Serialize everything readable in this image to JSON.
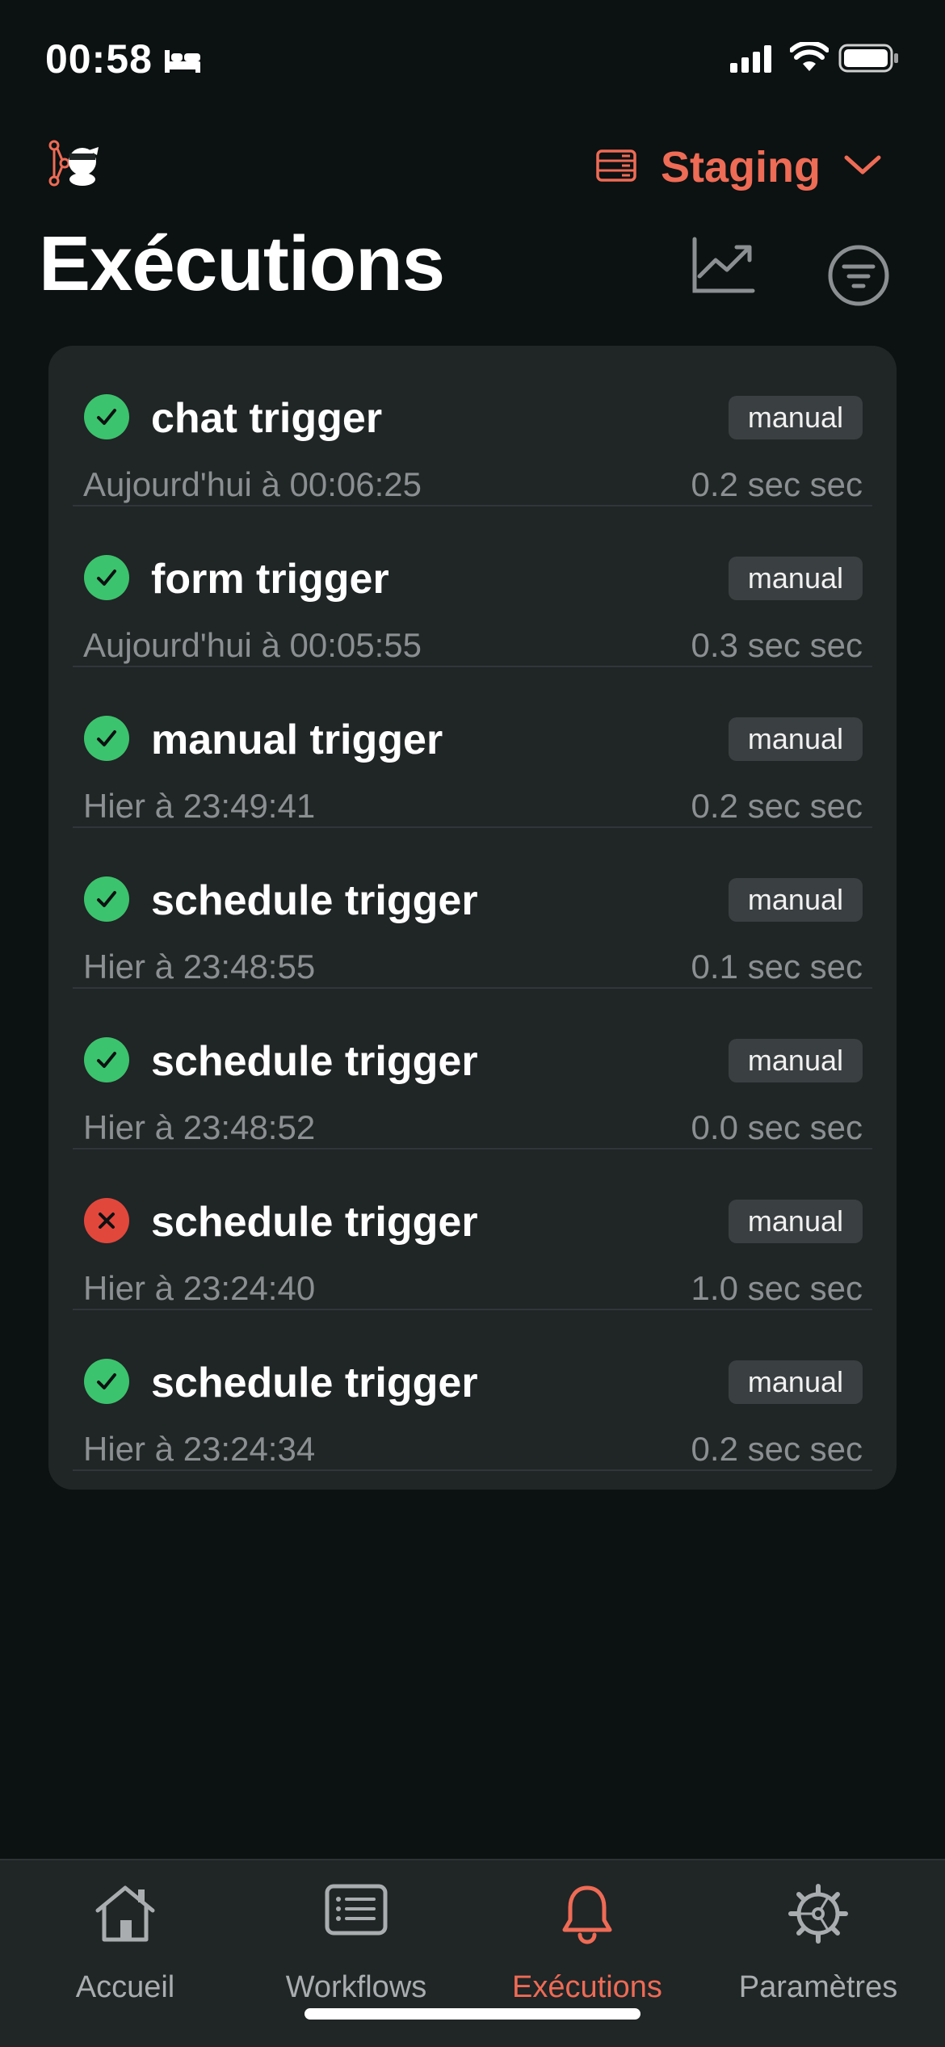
{
  "status_bar": {
    "time": "00:58"
  },
  "header": {
    "environment": "Staging",
    "title": "Exécutions"
  },
  "executions": [
    {
      "name": "chat trigger",
      "mode": "manual",
      "time": "Aujourd'hui à 00:06:25",
      "duration": "0.2 sec sec",
      "status": "success"
    },
    {
      "name": "form trigger",
      "mode": "manual",
      "time": "Aujourd'hui à 00:05:55",
      "duration": "0.3 sec sec",
      "status": "success"
    },
    {
      "name": "manual trigger",
      "mode": "manual",
      "time": "Hier à 23:49:41",
      "duration": "0.2 sec sec",
      "status": "success"
    },
    {
      "name": "schedule trigger",
      "mode": "manual",
      "time": "Hier à 23:48:55",
      "duration": "0.1 sec sec",
      "status": "success"
    },
    {
      "name": "schedule trigger",
      "mode": "manual",
      "time": "Hier à 23:48:52",
      "duration": "0.0 sec sec",
      "status": "success"
    },
    {
      "name": "schedule trigger",
      "mode": "manual",
      "time": "Hier à 23:24:40",
      "duration": "1.0 sec sec",
      "status": "error"
    },
    {
      "name": "schedule trigger",
      "mode": "manual",
      "time": "Hier à 23:24:34",
      "duration": "0.2 sec sec",
      "status": "success"
    }
  ],
  "tabs": [
    {
      "label": "Accueil",
      "icon": "home-icon",
      "active": false
    },
    {
      "label": "Workflows",
      "icon": "workflows-icon",
      "active": false
    },
    {
      "label": "Exécutions",
      "icon": "bell-icon",
      "active": true
    },
    {
      "label": "Paramètres",
      "icon": "gear-icon",
      "active": false
    }
  ],
  "colors": {
    "accent": "#ee6b55",
    "success": "#3cc36d",
    "error": "#e2473c",
    "background": "#0c1112",
    "card": "#202526"
  }
}
